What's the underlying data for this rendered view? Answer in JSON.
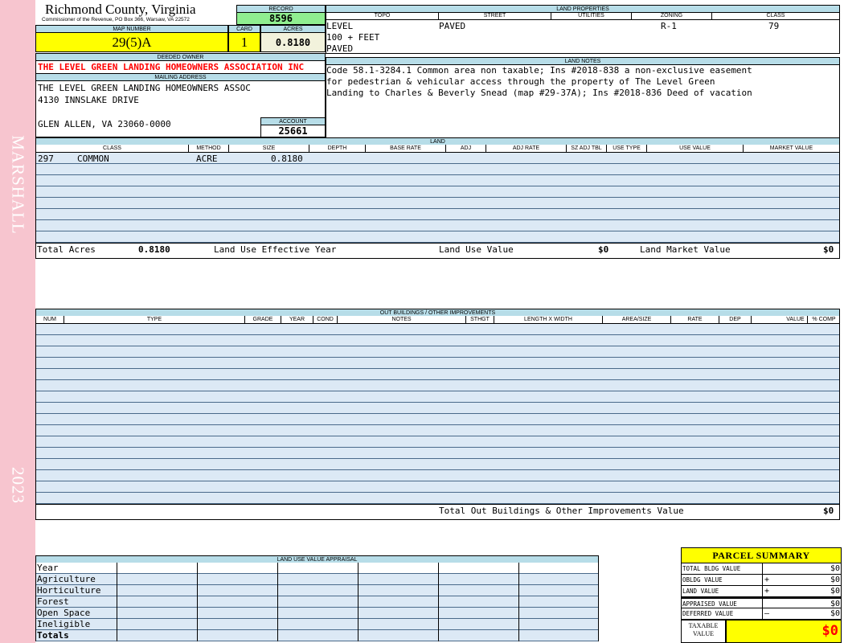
{
  "side": {
    "name": "MARSHALL",
    "year": "2023"
  },
  "header": {
    "county": "Richmond County, Virginia",
    "office": "Commissioner of the Revenue, PO Box 366, Warsaw, VA 22572",
    "record_label": "RECORD",
    "record_value": "8596",
    "map_label": "MAP NUMBER",
    "map_value": "29(5)A",
    "card_label": "CARD",
    "card_value": "1",
    "acres_label": "ACRES",
    "acres_value": "0.8180"
  },
  "owner": {
    "deeded_label": "DEEDED OWNER",
    "deeded_value": "THE LEVEL GREEN LANDING HOMEOWNERS ASSOCIATION INC",
    "mailing_label": "MAILING ADDRESS",
    "line1": "THE LEVEL GREEN LANDING HOMEOWNERS ASSOC",
    "line2": "4130 INNSLAKE DRIVE",
    "line3": "GLEN ALLEN, VA 23060-0000",
    "account_label": "ACCOUNT",
    "account_value": "25661"
  },
  "land_properties": {
    "title": "LAND PROPERTIES",
    "columns": [
      "TOPO",
      "STREET",
      "UTILITIES",
      "ZONING",
      "CLASS"
    ],
    "topo": [
      "LEVEL",
      "100 + FEET",
      "PAVED"
    ],
    "street": "PAVED",
    "zoning": "R-1",
    "class": "79"
  },
  "land_notes": {
    "title": "LAND NOTES",
    "lines": [
      "Code 58.1-3284.1 Common area non taxable; Ins #2018-838 a non-exclusive easement",
      "for pedestrian & vehicular access through the property of The Level Green",
      "Landing to Charles & Beverly Snead (map #29-37A); Ins #2018-836 Deed of vacation"
    ]
  },
  "land": {
    "title": "LAND",
    "columns": [
      "CLASS",
      "METHOD",
      "SIZE",
      "DEPTH",
      "BASE RATE",
      "ADJ",
      "ADJ RATE",
      "SZ ADJ TBL",
      "USE TYPE",
      "USE VALUE",
      "MARKET VALUE"
    ],
    "row": {
      "class_code": "297",
      "class_desc": "COMMON",
      "method": "ACRE",
      "size": "0.8180"
    },
    "total_acres_label": "Total Acres",
    "total_acres": "0.8180",
    "effective_year_label": "Land Use Effective Year",
    "use_value_label": "Land Use Value",
    "use_value": "$0",
    "market_value_label": "Land Market Value",
    "market_value": "$0"
  },
  "outbuildings": {
    "title": "OUT BUILDINGS / OTHER IMPROVEMENTS",
    "columns": [
      "NUM",
      "TYPE",
      "GRADE",
      "YEAR",
      "COND",
      "NOTES",
      "STHGT",
      "LENGTH X WIDTH",
      "AREA/SIZE",
      "RATE",
      "DEP",
      "VALUE",
      "% COMP"
    ],
    "total_label": "Total Out Buildings & Other Improvements Value",
    "total_value": "$0"
  },
  "land_use": {
    "title": "LAND USE VALUE APPRAISAL",
    "rows": [
      "Year",
      "Agriculture",
      "Horticulture",
      "Forest",
      "Open Space",
      "Ineligible",
      "Totals"
    ]
  },
  "summary": {
    "title": "PARCEL SUMMARY",
    "rows": [
      {
        "label": "TOTAL BLDG VALUE",
        "op": "",
        "value": "$0"
      },
      {
        "label": "OBLDG VALUE",
        "op": "+",
        "value": "$0"
      },
      {
        "label": "LAND VALUE",
        "op": "+",
        "value": "$0"
      },
      {
        "label": "APPRAISED VALUE",
        "op": "",
        "value": "$0"
      },
      {
        "label": "DEFERRED VALUE",
        "op": "–",
        "value": "$0"
      }
    ],
    "taxable_label_1": "TAXABLE",
    "taxable_label_2": "VALUE",
    "taxable_value": "$0"
  },
  "colors": {
    "side": "#f7c5cf",
    "header_blue": "#b7dde8",
    "yellow": "#ffff00",
    "green": "#90ee90",
    "red": "#ff0000"
  }
}
